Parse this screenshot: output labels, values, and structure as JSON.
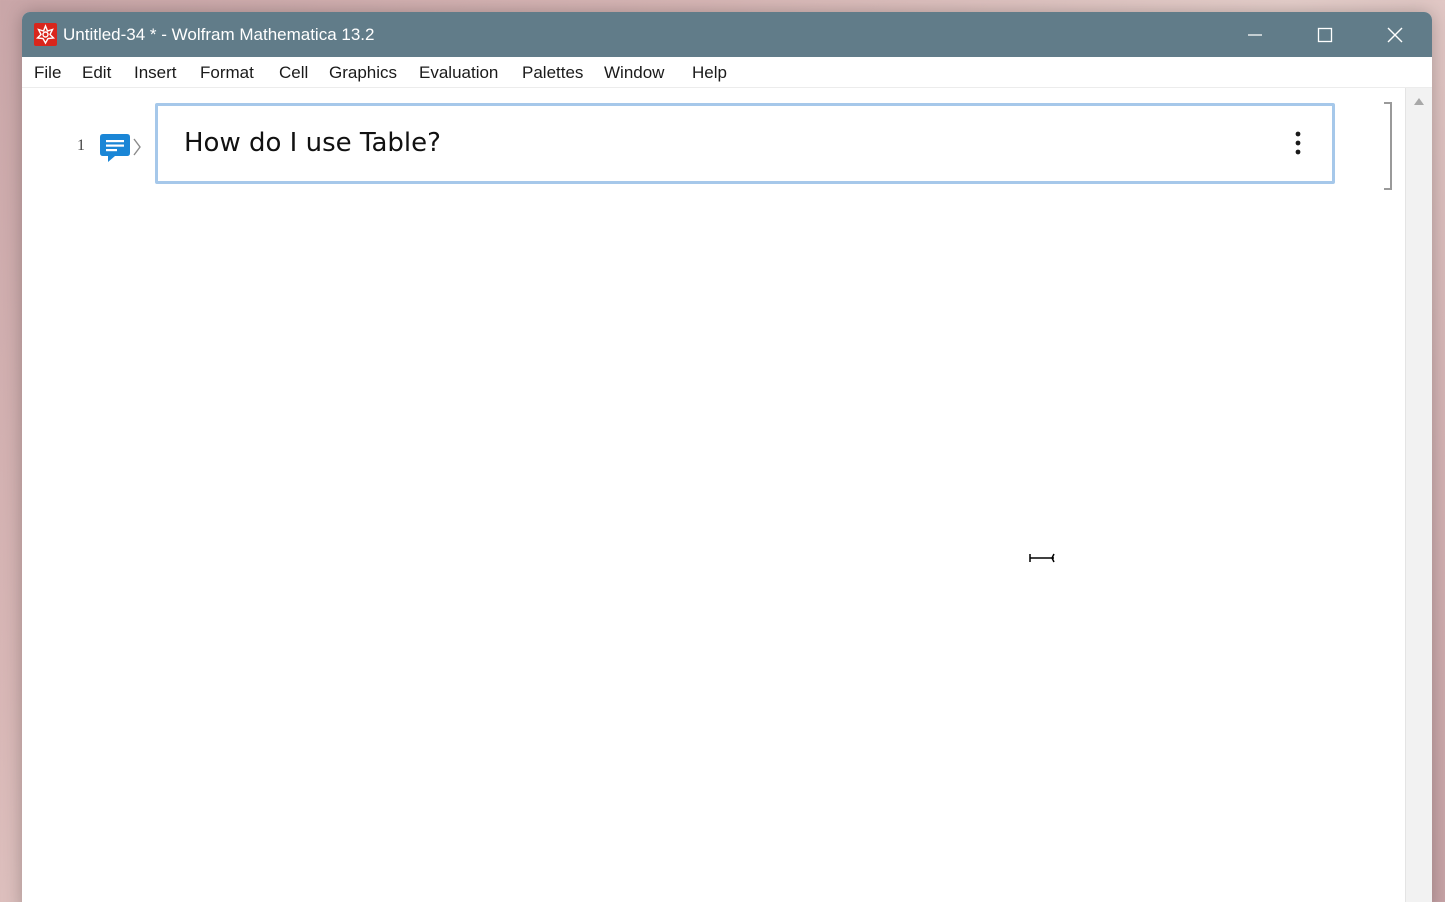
{
  "window": {
    "title": "Untitled-34 * - Wolfram Mathematica 13.2",
    "app_icon": "wolfram-spikey-icon",
    "controls": [
      "minimize-icon",
      "maximize-icon",
      "close-icon"
    ]
  },
  "menu": {
    "items": [
      {
        "label": "File"
      },
      {
        "label": "Edit"
      },
      {
        "label": "Insert"
      },
      {
        "label": "Format"
      },
      {
        "label": "Cell"
      },
      {
        "label": "Graphics"
      },
      {
        "label": "Evaluation"
      },
      {
        "label": "Palettes"
      },
      {
        "label": "Window"
      },
      {
        "label": "Help"
      }
    ]
  },
  "notebook": {
    "cell": {
      "label": "1",
      "type_icon": "chat-input-icon",
      "text": "How do I use Table?",
      "menu_icon": "vertical-ellipsis-icon"
    }
  },
  "colors": {
    "titlebar": "#617c89",
    "cell_border": "#a6c8ea",
    "chat_icon": "#1a86d6",
    "app_icon": "#d9261c"
  }
}
